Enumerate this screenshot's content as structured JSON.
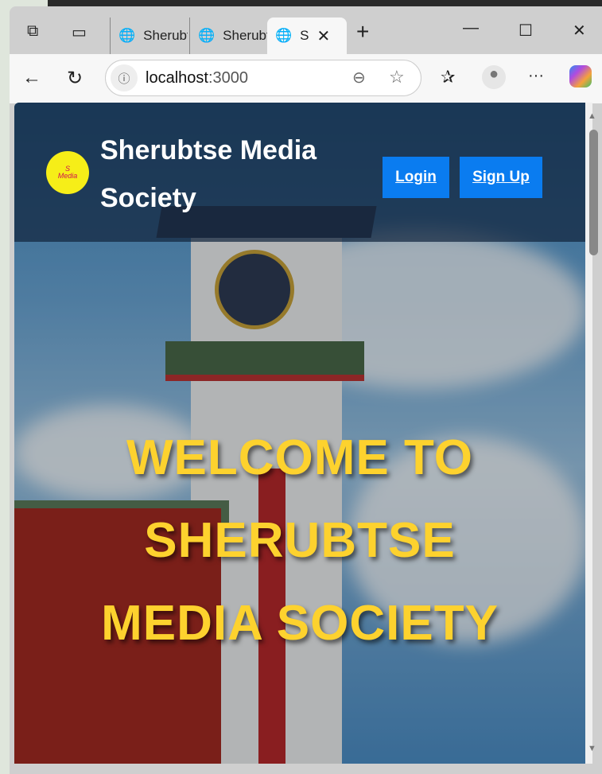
{
  "browser": {
    "tabs": [
      {
        "label": "Sherubtse"
      },
      {
        "label": "Sherubtse"
      },
      {
        "label": "S"
      }
    ],
    "url_host": "localhost",
    "url_port": ":3000"
  },
  "nav": {
    "brand": "Sherubtse Media Society",
    "logo_text": "Sherubtse Media Society",
    "login": "Login",
    "signup": "Sign Up"
  },
  "hero": {
    "line1": "WELCOME TO",
    "line2": "SHERUBTSE",
    "line3": "MEDIA SOCIETY"
  },
  "colors": {
    "accent": "#0a7cf0",
    "hero_text": "#fdd22e",
    "navbar": "#12263e"
  }
}
